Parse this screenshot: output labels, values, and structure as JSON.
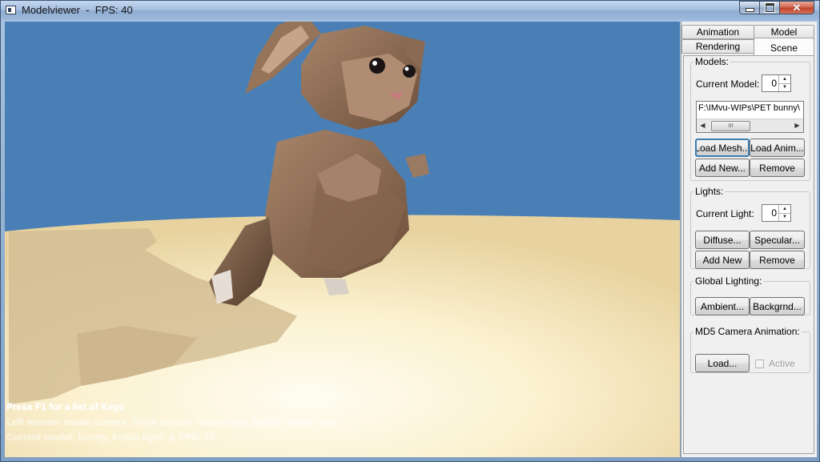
{
  "window": {
    "title": "Modelviewer  -  FPS: 40",
    "icons": {
      "app": "window-icon",
      "minimize": "minimize-icon",
      "maximize": "maximize-icon",
      "close": "close-icon"
    }
  },
  "viewport": {
    "overlay_lines": [
      "Press F1 for a list of Keys",
      "Left mouse: rotate camera, Right mouse: rotate light, Middle mouse: pan",
      "Current model: bunny, Active light: 0, FPS: 40"
    ],
    "colors": {
      "sky": "#4a7fb5",
      "ground": "#f3e8c0"
    }
  },
  "tabs": {
    "row1": [
      "Animation",
      "Model"
    ],
    "row2": [
      "Rendering",
      "Scene"
    ],
    "active": "Scene"
  },
  "models": {
    "legend": "Models:",
    "current_label": "Current Model:",
    "current_value": "0",
    "path": "F:\\IMvu-WIPs\\PET bunny\\",
    "scroll_thumb": "III",
    "load_mesh": "Load Mesh...",
    "load_anim": "Load Anim...",
    "add_new": "Add New...",
    "remove": "Remove"
  },
  "lights": {
    "legend": "Lights:",
    "current_label": "Current Light:",
    "current_value": "0",
    "diffuse": "Diffuse...",
    "specular": "Specular...",
    "add_new": "Add New",
    "remove": "Remove"
  },
  "global_lighting": {
    "legend": "Global Lighting:",
    "ambient": "Ambient...",
    "background": "Backgrnd..."
  },
  "camera_anim": {
    "legend": "MD5 Camera Animation:",
    "load": "Load...",
    "active_label": "Active",
    "active_checked": false
  }
}
